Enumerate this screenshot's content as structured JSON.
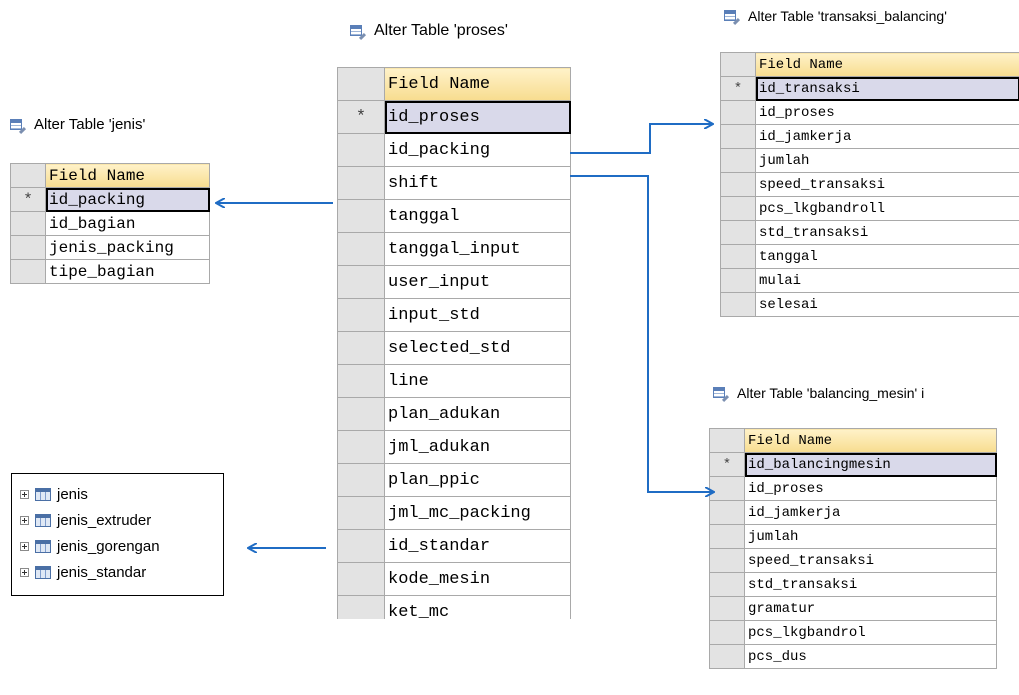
{
  "colors": {
    "arrow": "#1f6cc4",
    "header_gradient_top": "#fff2c9",
    "header_gradient_bottom": "#f7dc8f",
    "active_row": "#d9d9ea"
  },
  "tables": {
    "jenis": {
      "title": "Alter Table 'jenis'",
      "header": "Field Name",
      "marker": "*",
      "fields": [
        "id_packing",
        "id_bagian",
        "jenis_packing",
        "tipe_bagian"
      ]
    },
    "proses": {
      "title": "Alter Table 'proses'",
      "header": "Field Name",
      "marker": "*",
      "fields": [
        "id_proses",
        "id_packing",
        "shift",
        "tanggal",
        "tanggal_input",
        "user_input",
        "input_std",
        "selected_std",
        "line",
        "plan_adukan",
        "jml_adukan",
        "plan_ppic",
        "jml_mc_packing",
        "id_standar",
        "kode_mesin",
        "ket_mc"
      ]
    },
    "transaksi_balancing": {
      "title": "Alter Table 'transaksi_balancing'",
      "header": "Field Name",
      "marker": "*",
      "fields": [
        "id_transaksi",
        "id_proses",
        "id_jamkerja",
        "jumlah",
        "speed_transaksi",
        "pcs_lkgbandroll",
        "std_transaksi",
        "tanggal",
        "mulai",
        "selesai"
      ]
    },
    "balancing_mesin": {
      "title": "Alter Table 'balancing_mesin' i",
      "header": "Field Name",
      "marker": "*",
      "fields": [
        "id_balancingmesin",
        "id_proses",
        "id_jamkerja",
        "jumlah",
        "speed_transaksi",
        "std_transaksi",
        "gramatur",
        "pcs_lkgbandrol",
        "pcs_dus"
      ]
    }
  },
  "tree": {
    "items": [
      "jenis",
      "jenis_extruder",
      "jenis_gorengan",
      "jenis_standar"
    ]
  }
}
